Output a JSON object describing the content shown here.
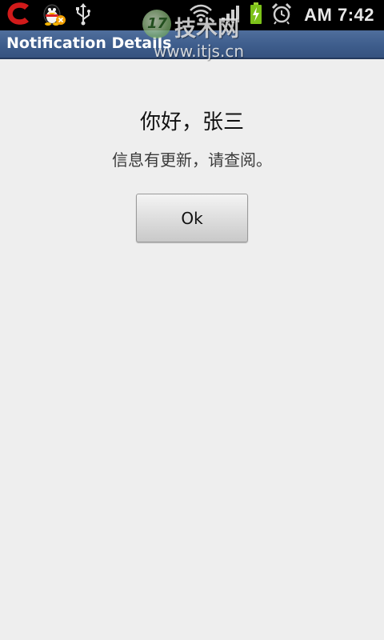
{
  "status_bar": {
    "time": "AM 7:42",
    "left_icons": [
      "c-app-icon",
      "qq-penguin-icon",
      "usb-icon"
    ],
    "right_icons": [
      "wifi-icon",
      "signal-icon",
      "battery-charging-icon",
      "alarm-clock-icon"
    ]
  },
  "watermark": {
    "logo_text": "17",
    "chinese_text": "技术网",
    "url": "www.itjs.cn"
  },
  "title_bar": {
    "title": "Notification Details",
    "color": "#3e5d8c"
  },
  "notification": {
    "greeting": "你好，张三",
    "message": "信息有更新，请查阅。",
    "ok_button_label": "Ok"
  }
}
